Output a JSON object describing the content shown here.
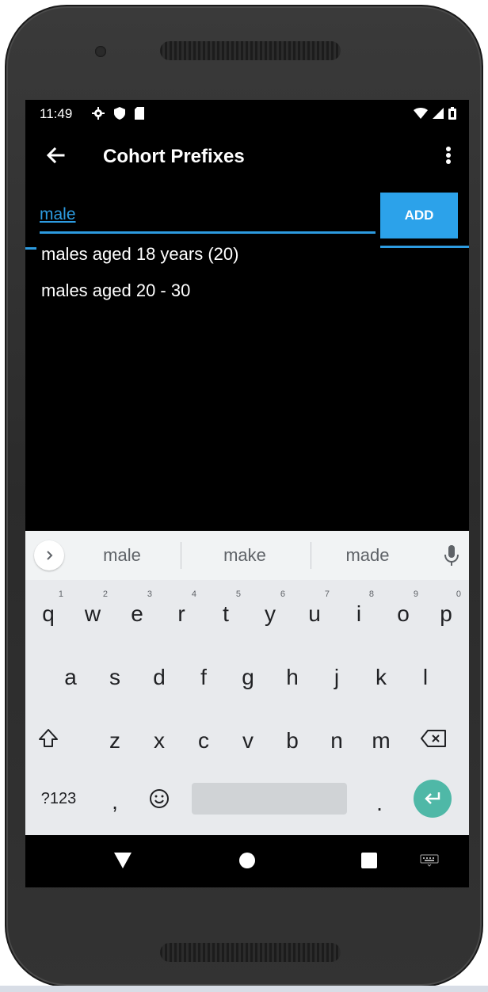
{
  "status_bar": {
    "time": "11:49"
  },
  "app_bar": {
    "title": "Cohort Prefixes"
  },
  "input": {
    "value": "male"
  },
  "add_button": {
    "label": "ADD"
  },
  "suggestions": [
    {
      "label": "males aged 18 years (20)"
    },
    {
      "label": "males aged 20 - 30"
    }
  ],
  "keyboard": {
    "word_suggestions": [
      "male",
      "make",
      "made"
    ],
    "row1": [
      {
        "ch": "q",
        "hint": "1"
      },
      {
        "ch": "w",
        "hint": "2"
      },
      {
        "ch": "e",
        "hint": "3"
      },
      {
        "ch": "r",
        "hint": "4"
      },
      {
        "ch": "t",
        "hint": "5"
      },
      {
        "ch": "y",
        "hint": "6"
      },
      {
        "ch": "u",
        "hint": "7"
      },
      {
        "ch": "i",
        "hint": "8"
      },
      {
        "ch": "o",
        "hint": "9"
      },
      {
        "ch": "p",
        "hint": "0"
      }
    ],
    "row2": [
      "a",
      "s",
      "d",
      "f",
      "g",
      "h",
      "j",
      "k",
      "l"
    ],
    "row3": [
      "z",
      "x",
      "c",
      "v",
      "b",
      "n",
      "m"
    ],
    "symbols_label": "?123",
    "comma_label": ",",
    "period_label": "."
  },
  "colors": {
    "accent": "#2ca2ea",
    "enter_key": "#4fb8a7",
    "screen_bg": "#000000",
    "keyboard_bg": "#e8eaed"
  }
}
